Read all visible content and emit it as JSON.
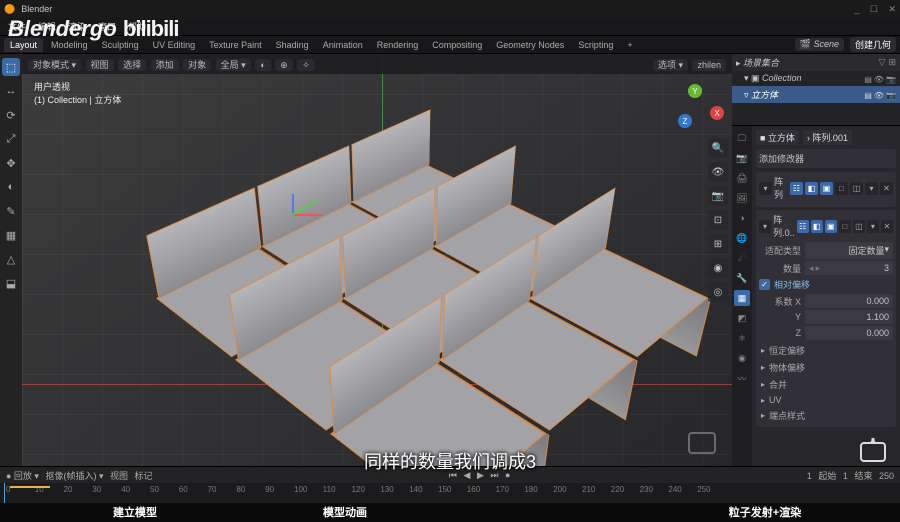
{
  "titlebar": {
    "app": "Blender",
    "win": [
      "_",
      "☐",
      "✕"
    ]
  },
  "menubar": [
    "文件",
    "编辑",
    "渲染",
    "窗口",
    "帮助"
  ],
  "workspaces": {
    "tabs": [
      "Layout",
      "Modeling",
      "Sculpting",
      "UV Editing",
      "Texture Paint",
      "Shading",
      "Animation",
      "Rendering",
      "Compositing",
      "Geometry Nodes",
      "Scripting",
      "+"
    ],
    "active": 0,
    "scene": "Scene",
    "viewlayer": "创建几何"
  },
  "viewport": {
    "header_left": [
      "对象模式 ▾",
      "视图",
      "选择",
      "添加",
      "对象"
    ],
    "header_icons": [
      "全局 ▾",
      "◐",
      "⊕",
      "✧"
    ],
    "header_right": [
      "选项 ▾",
      "zhilen"
    ],
    "label_title": "用户透视",
    "label_sub": "(1) Collection | 立方体"
  },
  "left_tools": [
    "⬚",
    "↔",
    "⟳",
    "⤢",
    "✥",
    "◐",
    "✎",
    "▦",
    "△",
    "⬓"
  ],
  "right_view_tools": [
    "🔍",
    "👁",
    "📷",
    "⊡",
    "⊞",
    "◉",
    "◎"
  ],
  "outliner": {
    "header": "场景集合",
    "collection": "Collection",
    "active": "立方体",
    "row_icons": [
      "▤",
      "👁",
      "📷"
    ]
  },
  "props": {
    "crumb": [
      "■ 立方体",
      "› 阵列.001"
    ],
    "add": "添加修改器",
    "mod1": {
      "name": "阵列",
      "icons": [
        "▾",
        "☷",
        "◧",
        "▣",
        "□",
        "◫",
        "▾",
        "✕"
      ]
    },
    "mod2": {
      "name": "阵列.0..",
      "icons": [
        "▾",
        "☷",
        "◧",
        "▣",
        "□",
        "◫",
        "▾",
        "✕"
      ],
      "fit_label": "适配类型",
      "fit_value": "固定数量",
      "count_label": "数量",
      "count_value": "3",
      "offset_check": "相对偏移",
      "axes": [
        {
          "l": "系数 X",
          "v": "0.000"
        },
        {
          "l": "Y",
          "v": "1.100"
        },
        {
          "l": "Z",
          "v": "0.000"
        }
      ],
      "collapsed": [
        "恒定偏移",
        "物体偏移",
        "合并",
        "UV",
        "端点样式"
      ]
    }
  },
  "prop_tabs": [
    "🖵",
    "📷",
    "🖨",
    "🖼",
    "◑",
    "🌐",
    "☄",
    "🔧",
    "▦",
    "◩",
    "⚛",
    "◉",
    "〰"
  ],
  "prop_tab_active": 8,
  "timeline": {
    "left": [
      "● 回放 ▾",
      "抠像(帧插入) ▾",
      "视图",
      "标记"
    ],
    "play": [
      "⏮",
      "◀",
      "▶",
      "⏭",
      "●"
    ],
    "right": [
      "1",
      "起始",
      "1",
      "结束",
      "250"
    ],
    "ticks": [
      0,
      10,
      20,
      30,
      40,
      50,
      60,
      70,
      80,
      90,
      100,
      110,
      120,
      130,
      140,
      150,
      160,
      170,
      180,
      200,
      210,
      220,
      230,
      240,
      250
    ]
  },
  "footer": [
    "建立模型",
    "模型动画",
    "",
    "粒子发射+渲染"
  ],
  "subtitle": "同样的数量我们调成3",
  "watermark": "Blendergo bilibili"
}
